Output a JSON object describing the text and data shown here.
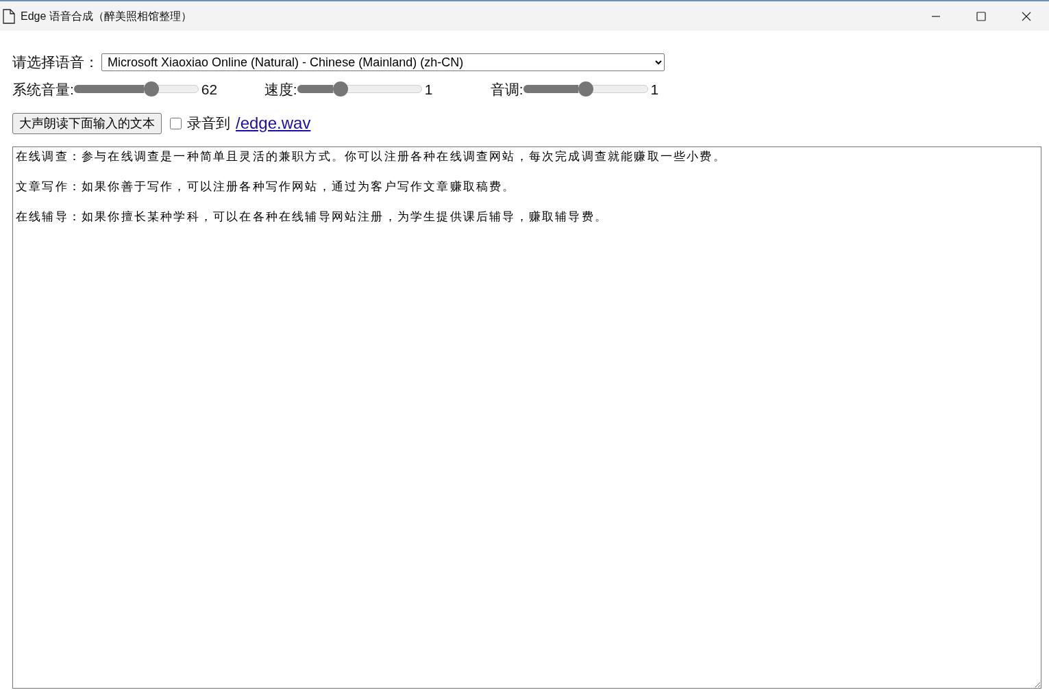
{
  "window": {
    "title": "Edge 语音合成（醉美照相馆整理）"
  },
  "voice": {
    "label": "请选择语音：",
    "value": "Microsoft Xiaoxiao Online (Natural) - Chinese (Mainland) (zh-CN)"
  },
  "sliders": [
    {
      "label": "系统音量:",
      "level": 0.62,
      "reading": "62"
    },
    {
      "label": "速度:",
      "level": 0.35,
      "reading": "1"
    },
    {
      "label": "音调:",
      "level": 0.5,
      "reading": "1"
    }
  ],
  "read_button": {
    "label": "大声朗读下面输入的文本"
  },
  "record": {
    "label": "录音到",
    "checked": false,
    "link": "/edge.wav"
  },
  "text_area": {
    "paragraphs": [
      "在线调查：参与在线调查是一种简单且灵活的兼职方式。你可以注册各种在线调查网站，每次完成调查就能赚取一些小费。",
      "文章写作：如果你善于写作，可以注册各种写作网站，通过为客户写作文章赚取稿费。",
      "在线辅导：如果你擅长某种学科，可以在各种在线辅导网站注册，为学生提供课后辅导，赚取辅导费。"
    ]
  }
}
